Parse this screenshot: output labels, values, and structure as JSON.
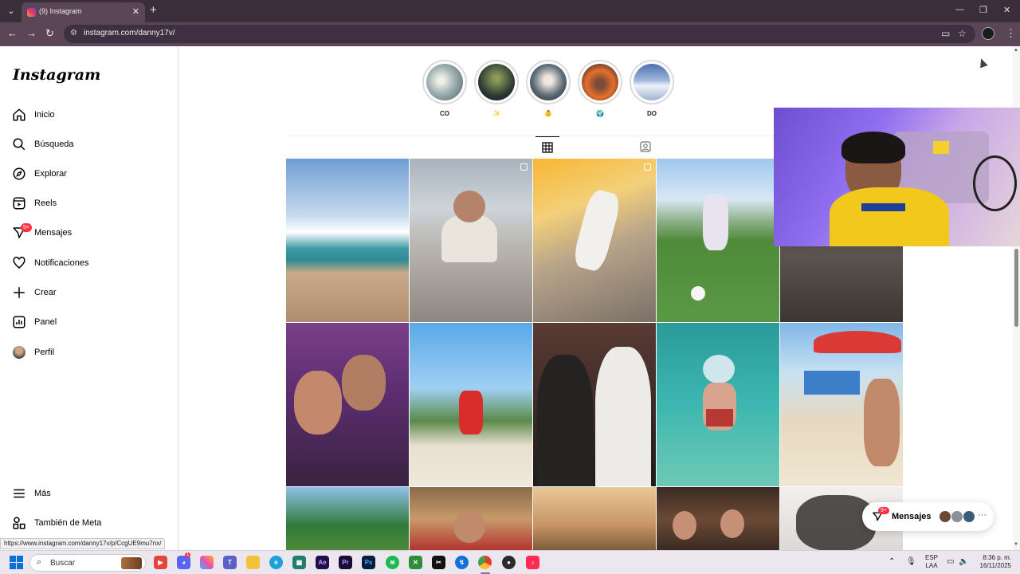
{
  "browser": {
    "tab_title": "(9) Instagram",
    "url": "instagram.com/danny17v/",
    "status_link": "https://www.instagram.com/danny17v/p/CcgUE9mu7nx/"
  },
  "sidebar": {
    "logo": "Instagram",
    "items": [
      {
        "label": "Inicio",
        "icon": "home-icon"
      },
      {
        "label": "Búsqueda",
        "icon": "search-icon"
      },
      {
        "label": "Explorar",
        "icon": "compass-icon"
      },
      {
        "label": "Reels",
        "icon": "reels-icon"
      },
      {
        "label": "Mensajes",
        "icon": "messenger-icon",
        "badge": "9+"
      },
      {
        "label": "Notificaciones",
        "icon": "heart-icon"
      },
      {
        "label": "Crear",
        "icon": "plus-icon"
      },
      {
        "label": "Panel",
        "icon": "chart-icon"
      },
      {
        "label": "Perfil",
        "icon": "avatar"
      }
    ],
    "more": "Más",
    "meta": "También de Meta"
  },
  "stories": [
    {
      "label": "CO"
    },
    {
      "label": "✨"
    },
    {
      "label": "👶"
    },
    {
      "label": "🌍"
    },
    {
      "label": "DO"
    }
  ],
  "messages_pill": {
    "label": "Mensajes",
    "badge": "9+",
    "more": "···"
  },
  "taskbar": {
    "search_placeholder": "Buscar",
    "lang_line1": "ESP",
    "lang_line2": "LAA",
    "time": "8:36 p. m.",
    "date": "16/11/2025",
    "notification_badge": "1"
  },
  "colors": {
    "accent": "#ff3040",
    "browser_frame": "#3a2e38",
    "toolbar": "#5a4656"
  }
}
